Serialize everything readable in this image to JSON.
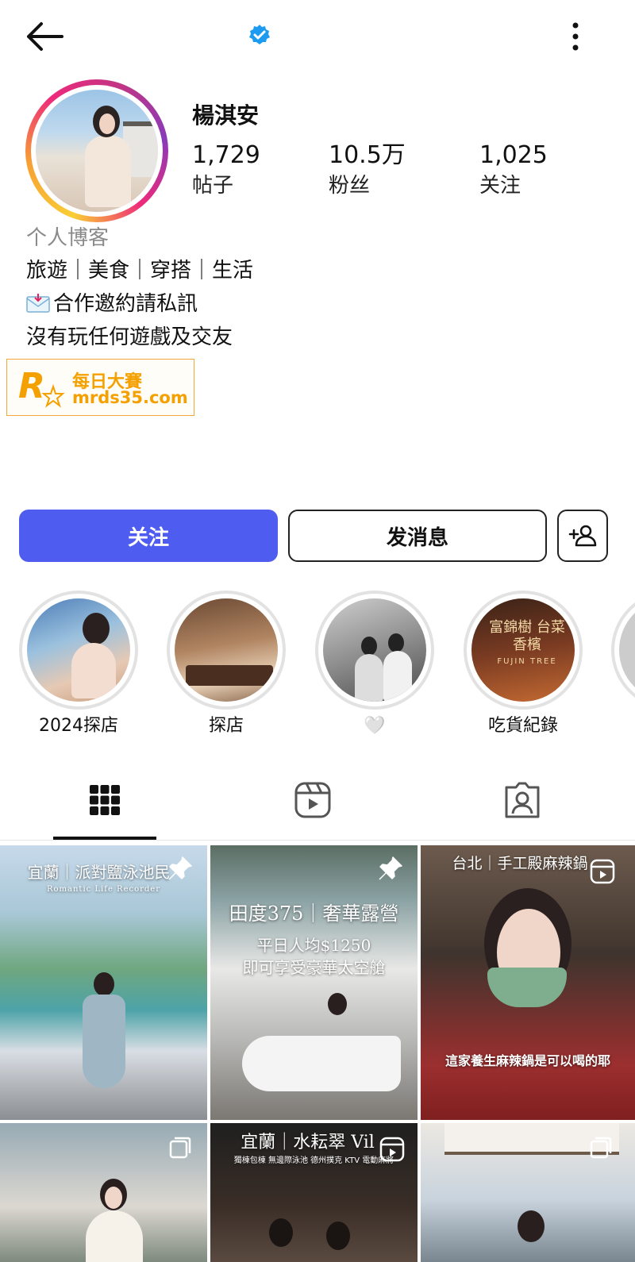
{
  "profile": {
    "username": "楊淇安",
    "stats": {
      "posts_count": "1,729",
      "posts_label": "帖子",
      "fans_count": "10.5万",
      "fans_label": "粉丝",
      "following_count": "1,025",
      "following_label": "关注"
    },
    "bio": {
      "category": "个人博客",
      "line1": "旅遊｜美食｜穿搭｜生活",
      "line2": "合作邀約請私訊",
      "line3": "沒有玩任何遊戲及交友"
    }
  },
  "watermark": {
    "line1": "每日大賽",
    "line2": "mrds35.com"
  },
  "actions": {
    "follow_label": "关注",
    "message_label": "发消息"
  },
  "highlights": [
    {
      "label": "2024探店"
    },
    {
      "label": "探店"
    },
    {
      "label": "🤍"
    },
    {
      "label": "吃貨紀錄",
      "cover_text": "富錦樹 台菜香檳",
      "cover_sub": "FUJIN TREE"
    }
  ],
  "posts": {
    "p1": {
      "caption": "宜蘭｜派對鹽泳池民",
      "sub": "Romantic Life Recorder"
    },
    "p2": {
      "caption": "田度375｜奢華露營",
      "line2": "平日人均$1250",
      "line3": "即可享受豪華太空艙"
    },
    "p3": {
      "caption": "台北｜手工殿麻辣鍋",
      "subtitle": "這家養生麻辣鍋是可以喝的耶"
    },
    "p5": {
      "caption": "宜蘭｜水耘翠 Vil",
      "sub": "獨棟包棟 無邊際泳池 德州撲克 KTV 電動麻將"
    }
  },
  "colors": {
    "follow_button": "#4f5cf0",
    "verified_badge": "#1d9bf0",
    "watermark": "#f4a000"
  }
}
